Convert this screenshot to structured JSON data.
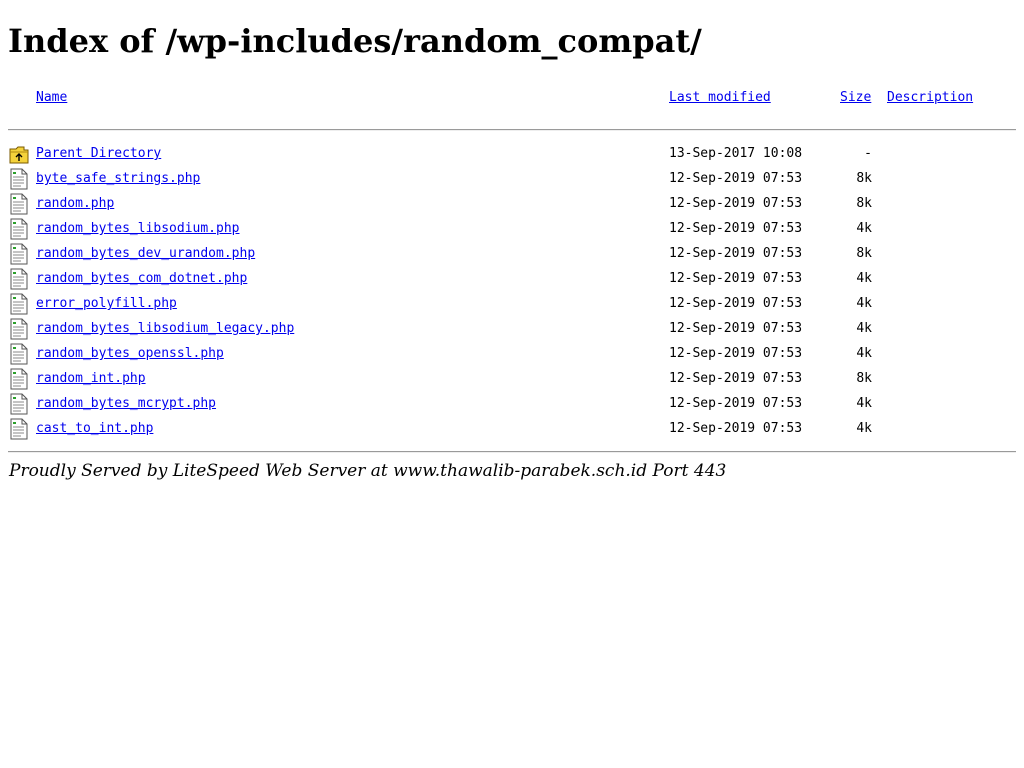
{
  "page": {
    "title": "Index of /wp-includes/random_compat/"
  },
  "columns": {
    "name": "Name",
    "last_modified": "Last modified",
    "size": "Size",
    "description": "Description"
  },
  "rows": [
    {
      "name": "Parent Directory",
      "modified": "13-Sep-2017 10:08",
      "size": "-",
      "icon": "folder-up-icon"
    },
    {
      "name": "byte_safe_strings.php",
      "modified": "12-Sep-2019 07:53",
      "size": "8k",
      "icon": "text-file-icon"
    },
    {
      "name": "random.php",
      "modified": "12-Sep-2019 07:53",
      "size": "8k",
      "icon": "text-file-icon"
    },
    {
      "name": "random_bytes_libsodium.php",
      "modified": "12-Sep-2019 07:53",
      "size": "4k",
      "icon": "text-file-icon"
    },
    {
      "name": "random_bytes_dev_urandom.php",
      "modified": "12-Sep-2019 07:53",
      "size": "8k",
      "icon": "text-file-icon"
    },
    {
      "name": "random_bytes_com_dotnet.php",
      "modified": "12-Sep-2019 07:53",
      "size": "4k",
      "icon": "text-file-icon"
    },
    {
      "name": "error_polyfill.php",
      "modified": "12-Sep-2019 07:53",
      "size": "4k",
      "icon": "text-file-icon"
    },
    {
      "name": "random_bytes_libsodium_legacy.php",
      "modified": "12-Sep-2019 07:53",
      "size": "4k",
      "icon": "text-file-icon"
    },
    {
      "name": "random_bytes_openssl.php",
      "modified": "12-Sep-2019 07:53",
      "size": "4k",
      "icon": "text-file-icon"
    },
    {
      "name": "random_int.php",
      "modified": "12-Sep-2019 07:53",
      "size": "8k",
      "icon": "text-file-icon"
    },
    {
      "name": "random_bytes_mcrypt.php",
      "modified": "12-Sep-2019 07:53",
      "size": "4k",
      "icon": "text-file-icon"
    },
    {
      "name": "cast_to_int.php",
      "modified": "12-Sep-2019 07:53",
      "size": "4k",
      "icon": "text-file-icon"
    }
  ],
  "footer": {
    "text": "Proudly Served by LiteSpeed Web Server at www.thawalib-parabek.sch.id Port 443"
  },
  "colors": {
    "link": "#0000ee",
    "folder_yellow": "#f4d23b",
    "rule": "#9a9a9a"
  }
}
